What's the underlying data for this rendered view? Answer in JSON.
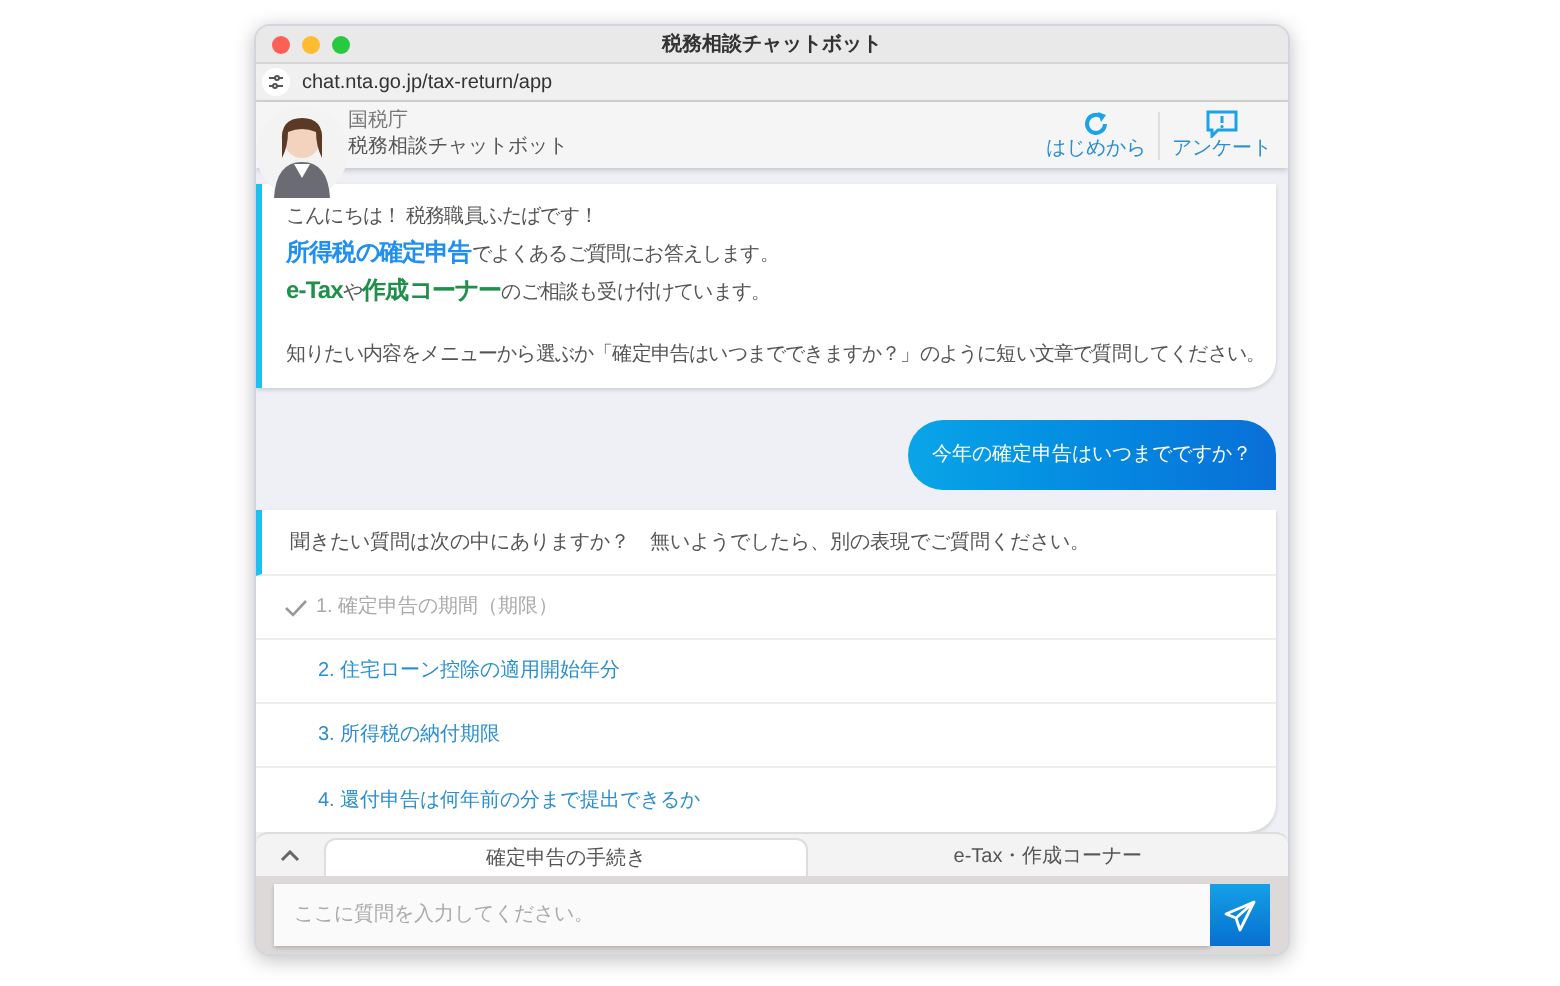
{
  "window": {
    "title": "税務相談チャットボット"
  },
  "address_bar": {
    "url": "chat.nta.go.jp/tax-return/app"
  },
  "header": {
    "agency": "国税庁",
    "title": "税務相談チャットボット",
    "actions": [
      {
        "kind": "restart",
        "label": "はじめから"
      },
      {
        "kind": "survey",
        "label": "アンケート"
      }
    ]
  },
  "messages": [
    {
      "kind": "bot",
      "paragraphs": [
        [
          [
            {
              "kind": "plain",
              "text": "こんにちは！ 税務職員ふたばです！"
            }
          ],
          [
            {
              "kind": "topic",
              "text": "所得税の確定申告"
            },
            {
              "kind": "plain",
              "text": "でよくあるご質問にお答えします。"
            }
          ],
          [
            {
              "kind": "service",
              "text": "e-Tax"
            },
            {
              "kind": "plain",
              "text": "や"
            },
            {
              "kind": "service",
              "text": "作成コーナー"
            },
            {
              "kind": "plain",
              "text": "のご相談も受け付けています。"
            }
          ]
        ],
        [
          [
            {
              "kind": "plain",
              "text": "知りたい内容をメニューから選ぶか「確定申告はいつまでできますか？」のように短い文章で質問してください。"
            }
          ]
        ]
      ]
    },
    {
      "kind": "user",
      "text": "今年の確定申告はいつまでですか？"
    },
    {
      "kind": "choices",
      "prompt": "聞きたい質問は次の中にありますか？　無いようでしたら、別の表現でご質問ください。",
      "options": [
        {
          "text": "1. 確定申告の期間（期限）",
          "checked": true
        },
        {
          "text": "2. 住宅ローン控除の適用開始年分",
          "checked": false
        },
        {
          "text": "3. 所得税の納付期限",
          "checked": false
        },
        {
          "text": "4. 還付申告は何年前の分まで提出できるか",
          "checked": false
        }
      ]
    }
  ],
  "menu_tabs": [
    {
      "label": "確定申告の手続き",
      "selected": true
    },
    {
      "label": "e-Tax・作成コーナー",
      "selected": false
    }
  ],
  "input": {
    "placeholder": "ここに質問を入力してください。"
  }
}
